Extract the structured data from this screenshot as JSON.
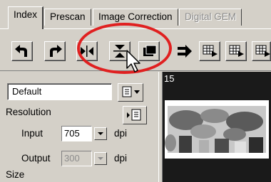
{
  "tabs": [
    {
      "label": "Index",
      "active": true,
      "enabled": true
    },
    {
      "label": "Prescan",
      "active": false,
      "enabled": true
    },
    {
      "label": "Image Correction",
      "active": false,
      "enabled": true
    },
    {
      "label": "Digital GEM",
      "active": false,
      "enabled": false
    }
  ],
  "toolbar": {
    "buttons": [
      "rotate-left-icon",
      "rotate-right-icon",
      "flip-horizontal-icon",
      "flip-vertical-icon",
      "crop-frame-icon",
      "next-frame-icon",
      "grid-select-icon",
      "grid-select-2-icon",
      "grid-select-3-icon"
    ],
    "highlight_color": "#e02020"
  },
  "settings": {
    "preset_value": "Default",
    "resolution_label": "Resolution",
    "input_label": "Input",
    "input_value": "705",
    "input_unit": "dpi",
    "output_label": "Output",
    "output_value": "300",
    "output_unit": "dpi",
    "size_label": "Size"
  },
  "preview": {
    "frame_number": "15"
  }
}
